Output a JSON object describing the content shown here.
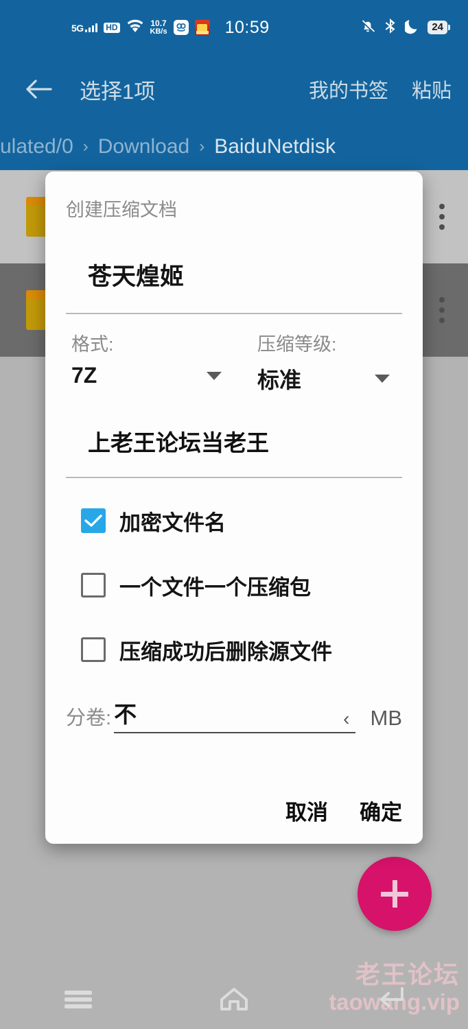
{
  "status_bar": {
    "network_label": "5G",
    "hd_label": "HD",
    "data_rate": "10.7",
    "data_rate_unit": "KB/s",
    "time": "10:59",
    "battery": "24",
    "icons": [
      "signal-bars-icon",
      "hd-icon",
      "wifi-icon",
      "data-rate-icon",
      "app-icon",
      "red-app-icon",
      "mute-bell-icon",
      "bluetooth-icon",
      "do-not-disturb-moon-icon",
      "battery-icon"
    ],
    "bg_color": "#13649e"
  },
  "app_bar": {
    "back_icon": "back-arrow-icon",
    "title": "选择1项",
    "actions": [
      {
        "label": "我的书签"
      },
      {
        "label": "粘贴"
      }
    ]
  },
  "breadcrumb": {
    "separator": "›",
    "items": [
      {
        "label": "ulated/0",
        "current": false
      },
      {
        "label": "Download",
        "current": false
      },
      {
        "label": "BaiduNetdisk",
        "current": true
      }
    ]
  },
  "file_list": {
    "rows": [
      {
        "icon": "folder-icon",
        "selected": false,
        "overflow": "more-vertical-icon"
      },
      {
        "icon": "folder-icon",
        "selected": true,
        "overflow": "more-vertical-icon"
      }
    ]
  },
  "fab": {
    "icon": "plus-icon",
    "color": "#d6126a"
  },
  "watermark": {
    "line1": "老王论坛",
    "line2": "taowang.vip",
    "color": "#f3c9cf"
  },
  "nav_bar": {
    "items": [
      {
        "icon": "recents-hamburger-icon"
      },
      {
        "icon": "home-icon"
      },
      {
        "icon": "back-icon"
      }
    ]
  },
  "dialog": {
    "title": "创建压缩文档",
    "filename": "苍天煌姬",
    "format": {
      "label": "格式:",
      "value": "7Z",
      "caret": "chevron-down-icon"
    },
    "level": {
      "label": "压缩等级:",
      "value": "标准",
      "caret": "chevron-down-icon"
    },
    "password": "上老王论坛当老王",
    "checkboxes": [
      {
        "label": "加密文件名",
        "checked": true
      },
      {
        "label": "一个文件一个压缩包",
        "checked": false
      },
      {
        "label": "压缩成功后删除源文件",
        "checked": false
      }
    ],
    "split": {
      "label": "分卷:",
      "value": "不",
      "chevron": "‹",
      "unit": "MB"
    },
    "buttons": {
      "cancel": "取消",
      "confirm": "确定"
    },
    "accent_color": "#27a7e8"
  }
}
